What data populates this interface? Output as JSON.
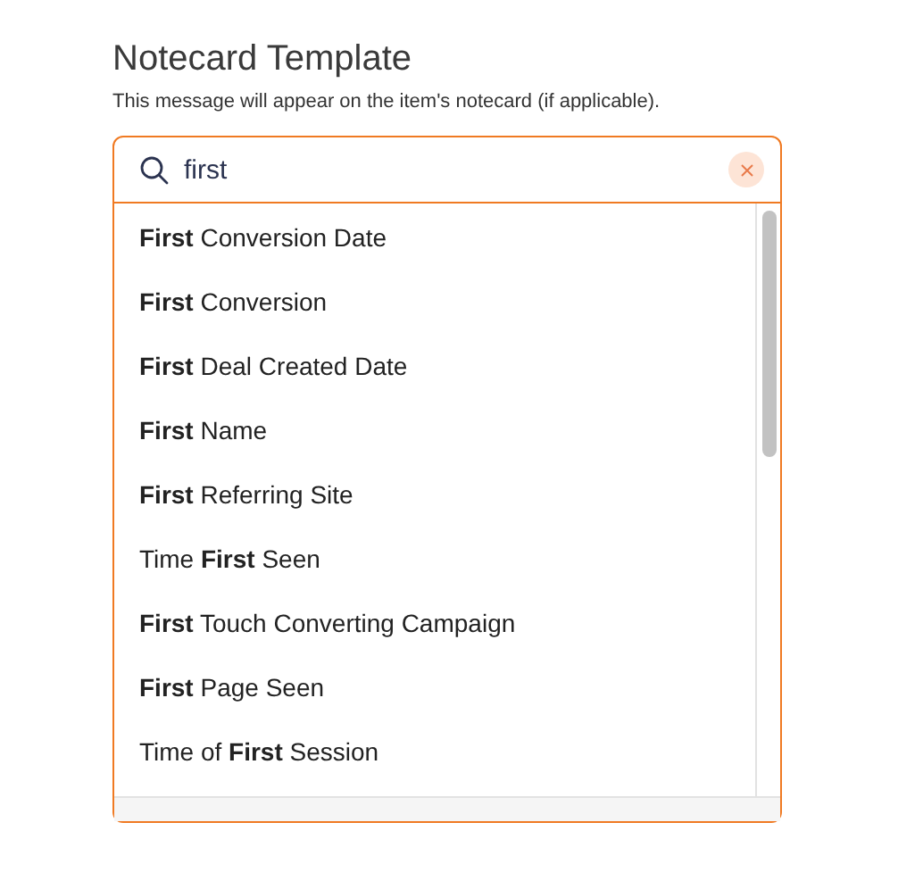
{
  "title": "Notecard Template",
  "description": "This message will appear on the item's notecard (if applicable).",
  "search": {
    "value": "first"
  },
  "options": [
    {
      "label": "**First** Conversion Date"
    },
    {
      "label": "**First** Conversion"
    },
    {
      "label": "**First** Deal Created Date"
    },
    {
      "label": "**First** Name"
    },
    {
      "label": "**First** Referring Site"
    },
    {
      "label": "Time **First** Seen"
    },
    {
      "label": "**First** Touch Converting Campaign"
    },
    {
      "label": "**First** Page Seen"
    },
    {
      "label": "Time of **First** Session"
    }
  ]
}
